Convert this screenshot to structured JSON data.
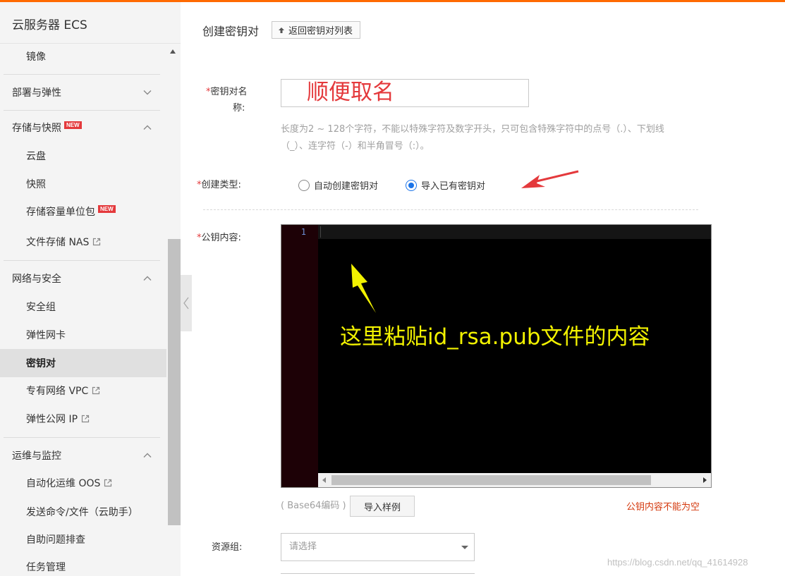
{
  "sidebar": {
    "title": "云服务器 ECS",
    "items": [
      {
        "label": "镜像"
      },
      {
        "label": "部署与弹性"
      },
      {
        "label": "存储与快照",
        "badge": "NEW"
      },
      {
        "label": "云盘"
      },
      {
        "label": "快照"
      },
      {
        "label": "存储容量单位包",
        "badge": "NEW"
      },
      {
        "label": "文件存储 NAS"
      },
      {
        "label": "网络与安全"
      },
      {
        "label": "安全组"
      },
      {
        "label": "弹性网卡"
      },
      {
        "label": "密钥对"
      },
      {
        "label": "专有网络 VPC"
      },
      {
        "label": "弹性公网 IP"
      },
      {
        "label": "运维与监控"
      },
      {
        "label": "自动化运维 OOS"
      },
      {
        "label": "发送命令/文件（云助手）"
      },
      {
        "label": "自助问题排查"
      },
      {
        "label": "任务管理"
      }
    ]
  },
  "header": {
    "title": "创建密钥对",
    "back_label": "返回密钥对列表"
  },
  "form": {
    "required_mark": "*",
    "name_label_line1": "密钥对名",
    "name_label_line2": "称:",
    "name_value": "顺便取名",
    "name_hint": "长度为2 ~ 128个字符，不能以特殊字符及数字开头，只可包含特殊字符中的点号（.）、下划线（_）、连字符（-）和半角冒号（:）。",
    "type_label": "创建类型:",
    "type_options": [
      "自动创建密钥对",
      "导入已有密钥对"
    ],
    "type_selected": 1,
    "pubkey_label": "公钥内容:",
    "editor_line_number": "1",
    "editor_annotation": "这里粘贴id_rsa.pub文件的内容",
    "base64_note": "( Base64编码 )",
    "sample_button": "导入样例",
    "error_message": "公钥内容不能为空",
    "resource_group_label": "资源组:",
    "resource_group_placeholder": "请选择"
  },
  "watermark": "https://blog.csdn.net/qq_41614928",
  "colors": {
    "accent": "#ff6a00",
    "required": "#e4393c",
    "annotation_red": "#e4393c",
    "annotation_yellow": "#f2f200",
    "radio_selected": "#1a73e8",
    "error": "#d4380d"
  }
}
